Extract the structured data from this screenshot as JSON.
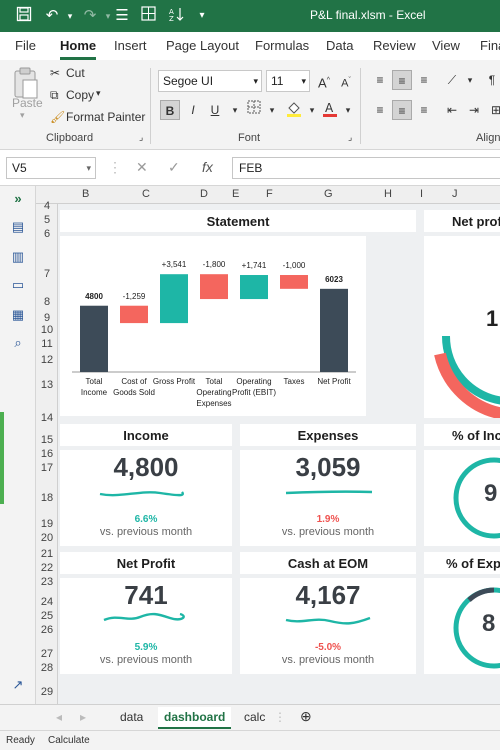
{
  "window": {
    "title": "P&L final.xlsm  -  Excel"
  },
  "menu": {
    "tabs": [
      "File",
      "Home",
      "Insert",
      "Page Layout",
      "Formulas",
      "Data",
      "Review",
      "View",
      "Fina"
    ],
    "active": "Home"
  },
  "ribbon": {
    "clipboard": {
      "paste": "Paste",
      "cut": "Cut",
      "copy": "Copy",
      "format_painter": "Format Painter",
      "label": "Clipboard"
    },
    "font": {
      "name": "Segoe UI",
      "size": "11",
      "label": "Font"
    },
    "alignment_label": "Alignm"
  },
  "formula_bar": {
    "name_box": "V5",
    "value": "FEB"
  },
  "grid": {
    "columns": [
      "B",
      "C",
      "D",
      "E",
      "F",
      "G",
      "H",
      "I",
      "J"
    ],
    "rows": [
      "4",
      "5",
      "6",
      "7",
      "8",
      "9",
      "10",
      "11",
      "12",
      "13",
      "14",
      "15",
      "16",
      "17",
      "18",
      "19",
      "20",
      "21",
      "22",
      "23",
      "24",
      "25",
      "26",
      "27",
      "28",
      "29"
    ]
  },
  "dashboard": {
    "statement": {
      "title": "Statement",
      "chart_data": {
        "type": "bar",
        "categories": [
          "Total Income",
          "Cost of Goods Sold",
          "Gross Profit",
          "Total Operating Expenses",
          "Operating Profit (EBIT)",
          "Taxes",
          "Net Profit"
        ],
        "category_labels": [
          [
            "Total",
            "Income"
          ],
          [
            "Cost of",
            "Goods Sold"
          ],
          [
            "Gross Profit"
          ],
          [
            "Total",
            "Operating",
            "Expenses"
          ],
          [
            "Operating",
            "Profit (EBIT)"
          ],
          [
            "Taxes"
          ],
          [
            "Net Profit"
          ]
        ],
        "value_labels": [
          "4800",
          "-1,259",
          "+3,541",
          "-1,800",
          "+1,741",
          "-1,000",
          "6023"
        ],
        "values": [
          4800,
          -1259,
          3541,
          -1800,
          1741,
          -1000,
          6023
        ],
        "kinds": [
          "total",
          "down",
          "up",
          "down",
          "up",
          "down",
          "total"
        ],
        "colors": {
          "total": "#3d4b58",
          "up": "#1eb6a6",
          "down": "#f4665e"
        }
      }
    },
    "net_profit_gauge": {
      "title": "Net prof",
      "value_partial": "1"
    },
    "income": {
      "title": "Income",
      "value": "4,800",
      "change": "6.6%",
      "sub": "vs. previous month",
      "trend": "up"
    },
    "expenses": {
      "title": "Expenses",
      "value": "3,059",
      "change": "1.9%",
      "sub": "vs. previous month",
      "trend": "down"
    },
    "pct_income": {
      "title": "% of Inc",
      "value_partial": "9"
    },
    "net_profit": {
      "title": "Net Profit",
      "value": "741",
      "change": "5.9%",
      "sub": "vs. previous month",
      "trend": "up"
    },
    "cash_eom": {
      "title": "Cash at EOM",
      "value": "4,167",
      "change": "-5.0%",
      "sub": "vs. previous month",
      "trend": "down"
    },
    "pct_expenses": {
      "title": "% of Expe",
      "value_partial": "8"
    }
  },
  "sheet_tabs": [
    "data",
    "dashboard",
    "calc"
  ],
  "active_sheet": "dashboard",
  "status": {
    "ready": "Ready",
    "calculate": "Calculate"
  },
  "colors": {
    "excel_green": "#217346",
    "teal": "#1eb6a6",
    "red": "#f4665e",
    "slate": "#3d4b58"
  }
}
